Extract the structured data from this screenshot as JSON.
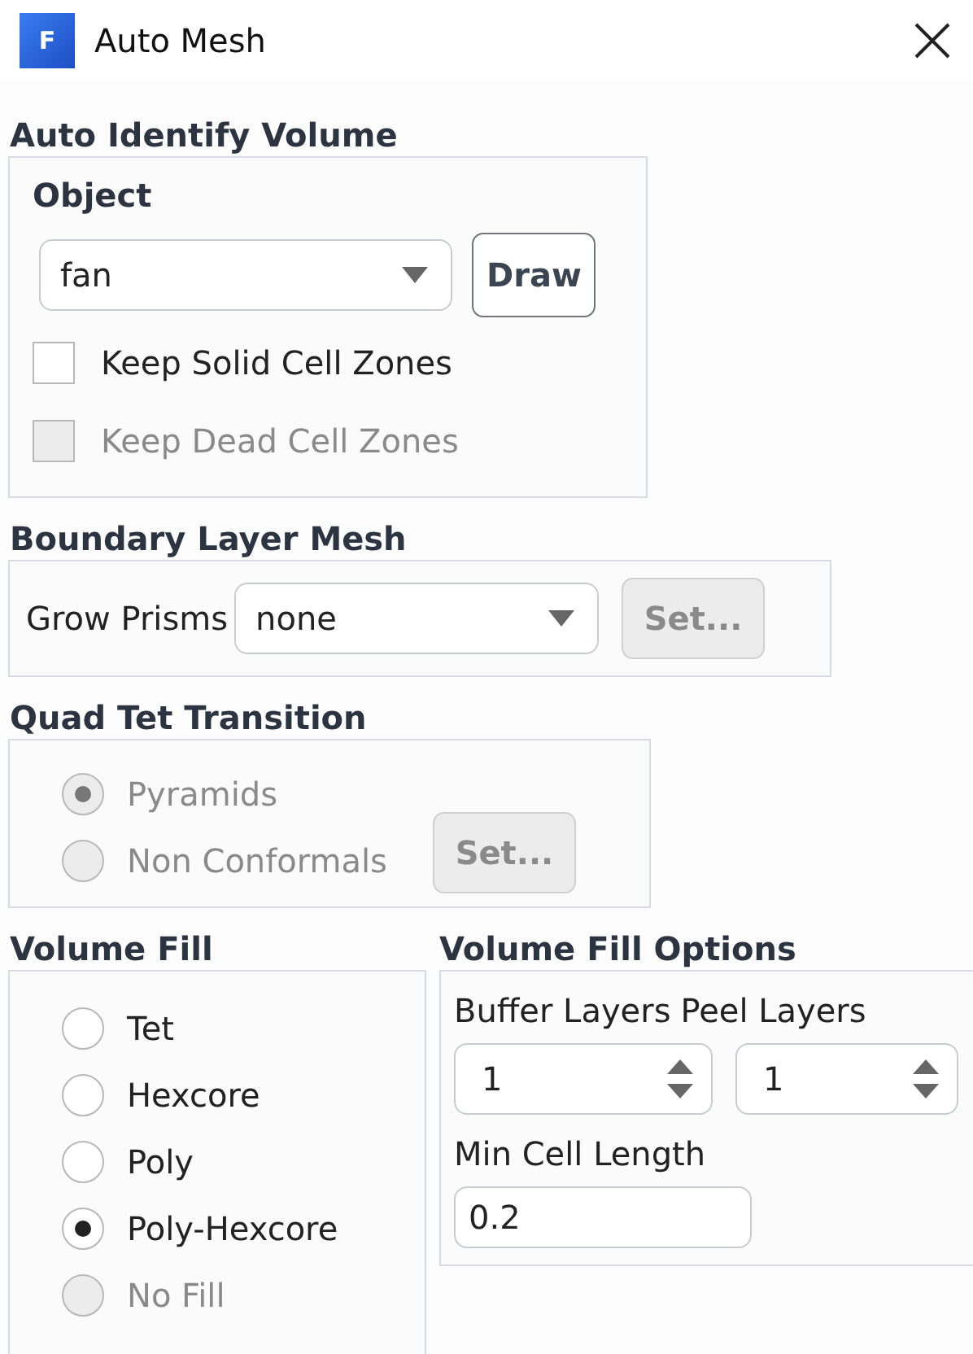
{
  "window": {
    "title": "Auto Mesh",
    "icon_letter": "F"
  },
  "auto_identify_volume": {
    "heading": "Auto Identify Volume",
    "object_label": "Object",
    "object_value": "fan",
    "draw_button": {
      "label": "Draw",
      "disabled": false
    },
    "checkboxes": [
      {
        "label": "Keep Solid Cell Zones",
        "checked": false,
        "disabled": false
      },
      {
        "label": "Keep Dead Cell Zones",
        "checked": false,
        "disabled": true
      }
    ]
  },
  "boundary_layer_mesh": {
    "heading": "Boundary Layer Mesh",
    "label": "Grow Prisms",
    "value": "none",
    "set_button": {
      "label": "Set...",
      "disabled": true
    }
  },
  "quad_tet_transition": {
    "heading": "Quad Tet Transition",
    "options": [
      {
        "label": "Pyramids",
        "selected": true,
        "disabled": true
      },
      {
        "label": "Non Conformals",
        "selected": false,
        "disabled": true
      }
    ],
    "set_button": {
      "label": "Set...",
      "disabled": true
    }
  },
  "volume_fill": {
    "heading": "Volume Fill",
    "options": [
      {
        "label": "Tet",
        "selected": false,
        "disabled": false
      },
      {
        "label": "Hexcore",
        "selected": false,
        "disabled": false
      },
      {
        "label": "Poly",
        "selected": false,
        "disabled": false
      },
      {
        "label": "Poly-Hexcore",
        "selected": true,
        "disabled": false
      },
      {
        "label": "No Fill",
        "selected": false,
        "disabled": true
      }
    ]
  },
  "volume_fill_options": {
    "heading": "Volume Fill Options",
    "buffer_layers": {
      "label": "Buffer Layers",
      "value": "1"
    },
    "peel_layers": {
      "label": "Peel Layers",
      "value": "1"
    },
    "min_cell_length": {
      "label": "Min Cell Length",
      "value": "0.2"
    }
  }
}
